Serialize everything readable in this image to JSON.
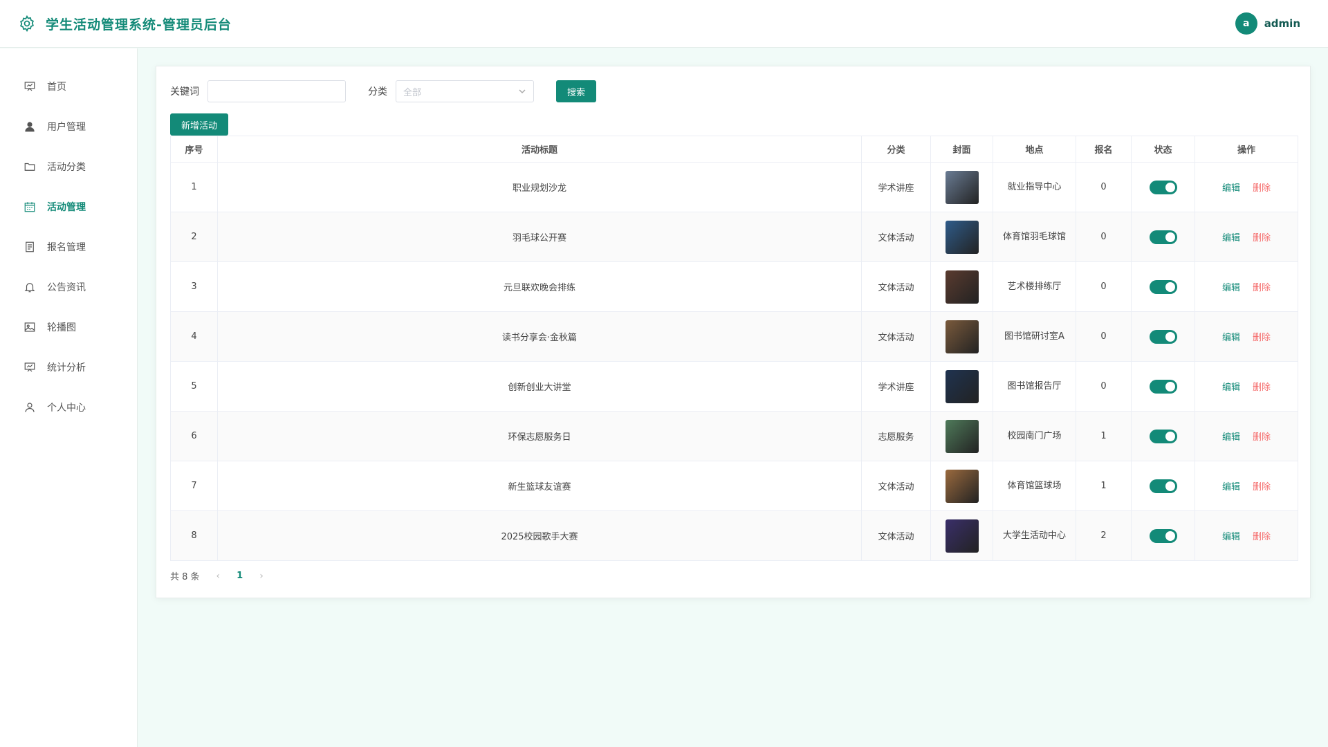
{
  "header": {
    "title": "学生活动管理系统-管理员后台",
    "avatar_letter": "a",
    "username": "admin"
  },
  "sidebar": {
    "items": [
      {
        "label": "首页",
        "icon": "presentation-icon"
      },
      {
        "label": "用户管理",
        "icon": "user-filled-icon"
      },
      {
        "label": "活动分类",
        "icon": "folder-icon"
      },
      {
        "label": "活动管理",
        "icon": "calendar-icon",
        "active": true
      },
      {
        "label": "报名管理",
        "icon": "document-icon"
      },
      {
        "label": "公告资讯",
        "icon": "bell-icon"
      },
      {
        "label": "轮播图",
        "icon": "image-icon"
      },
      {
        "label": "统计分析",
        "icon": "presentation-icon"
      },
      {
        "label": "个人中心",
        "icon": "user-icon"
      }
    ]
  },
  "filters": {
    "keyword_label": "关键词",
    "keyword_value": "",
    "category_label": "分类",
    "category_placeholder": "全部",
    "search_label": "搜索",
    "add_label": "新增活动"
  },
  "table": {
    "columns": [
      "序号",
      "活动标题",
      "分类",
      "封面",
      "地点",
      "报名",
      "状态",
      "操作"
    ],
    "rows": [
      {
        "no": "1",
        "title": "职业规划沙龙",
        "category": "学术讲座",
        "location": "就业指导中心",
        "signups": "0",
        "status_on": true,
        "cover_color": "#6a7c94"
      },
      {
        "no": "2",
        "title": "羽毛球公开赛",
        "category": "文体活动",
        "location": "体育馆羽毛球馆",
        "signups": "0",
        "status_on": true,
        "cover_color": "#2f5c8a"
      },
      {
        "no": "3",
        "title": "元旦联欢晚会排练",
        "category": "文体活动",
        "location": "艺术楼排练厅",
        "signups": "0",
        "status_on": true,
        "cover_color": "#5a3b2f"
      },
      {
        "no": "4",
        "title": "读书分享会·金秋篇",
        "category": "文体活动",
        "location": "图书馆研讨室A",
        "signups": "0",
        "status_on": true,
        "cover_color": "#7a5a3c"
      },
      {
        "no": "5",
        "title": "创新创业大讲堂",
        "category": "学术讲座",
        "location": "图书馆报告厅",
        "signups": "0",
        "status_on": true,
        "cover_color": "#1f3350"
      },
      {
        "no": "6",
        "title": "环保志愿服务日",
        "category": "志愿服务",
        "location": "校园南门广场",
        "signups": "1",
        "status_on": true,
        "cover_color": "#4f7a5a"
      },
      {
        "no": "7",
        "title": "新生篮球友谊赛",
        "category": "文体活动",
        "location": "体育馆篮球场",
        "signups": "1",
        "status_on": true,
        "cover_color": "#9a6a3e"
      },
      {
        "no": "8",
        "title": "2025校园歌手大赛",
        "category": "文体活动",
        "location": "大学生活动中心",
        "signups": "2",
        "status_on": true,
        "cover_color": "#3a2f6a"
      }
    ],
    "edit_label": "编辑",
    "delete_label": "删除"
  },
  "pagination": {
    "total_text": "共 8 条",
    "current_page": "1",
    "prev": "‹",
    "next": "›"
  },
  "colors": {
    "accent": "#138a78",
    "danger": "#f56c6c"
  }
}
